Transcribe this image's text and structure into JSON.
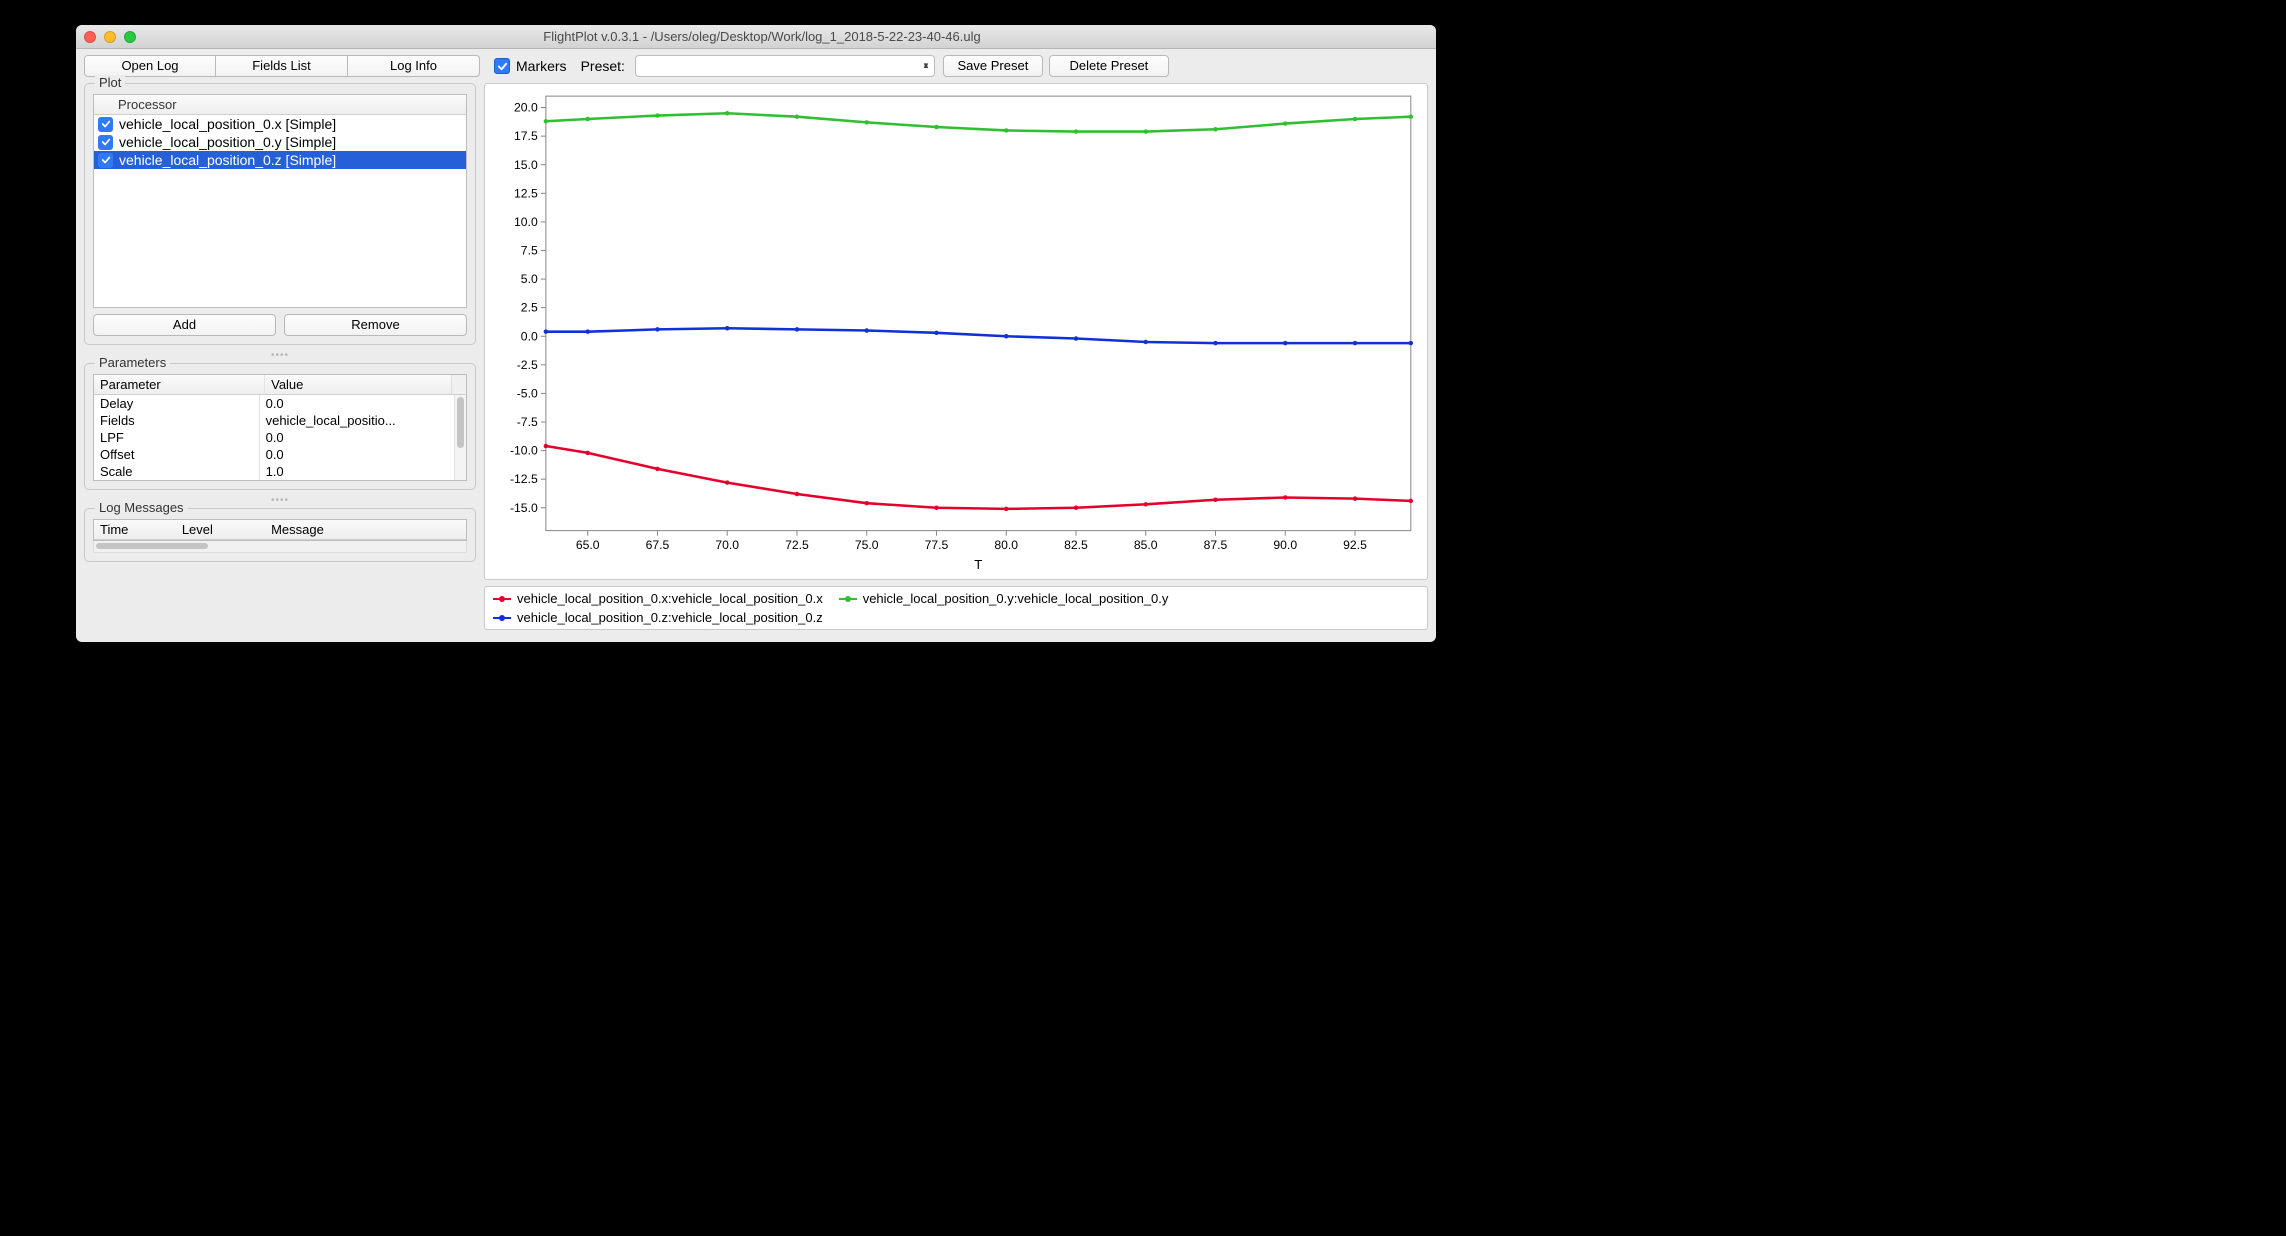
{
  "window": {
    "title": "FlightPlot v.0.3.1 - /Users/oleg/Desktop/Work/log_1_2018-5-22-23-40-46.ulg"
  },
  "toolbar": {
    "open_log": "Open Log",
    "fields_list": "Fields List",
    "log_info": "Log Info",
    "markers_checked": true,
    "markers_label": "Markers",
    "preset_label": "Preset:",
    "preset_value": "",
    "save_preset": "Save Preset",
    "delete_preset": "Delete Preset"
  },
  "plot_panel": {
    "title": "Plot",
    "header": "Processor",
    "items": [
      {
        "label": "vehicle_local_position_0.x [Simple]",
        "checked": true,
        "selected": false
      },
      {
        "label": "vehicle_local_position_0.y [Simple]",
        "checked": true,
        "selected": false
      },
      {
        "label": "vehicle_local_position_0.z [Simple]",
        "checked": true,
        "selected": true
      }
    ],
    "add": "Add",
    "remove": "Remove"
  },
  "parameters": {
    "title": "Parameters",
    "columns": [
      "Parameter",
      "Value"
    ],
    "rows": [
      {
        "name": "Delay",
        "value": "0.0"
      },
      {
        "name": "Fields",
        "value": "vehicle_local_positio..."
      },
      {
        "name": "LPF",
        "value": "0.0"
      },
      {
        "name": "Offset",
        "value": "0.0"
      },
      {
        "name": "Scale",
        "value": "1.0"
      }
    ]
  },
  "log_messages": {
    "title": "Log Messages",
    "columns": [
      "Time",
      "Level",
      "Message"
    ]
  },
  "legend": [
    {
      "color": "#e4002b",
      "label": "vehicle_local_position_0.x:vehicle_local_position_0.x"
    },
    {
      "color": "#2fbf2f",
      "label": "vehicle_local_position_0.y:vehicle_local_position_0.y"
    },
    {
      "color": "#1030d8",
      "label": "vehicle_local_position_0.z:vehicle_local_position_0.z"
    }
  ],
  "chart_data": {
    "type": "line",
    "xlabel": "T",
    "ylabel": "",
    "xlim": [
      63.5,
      94.5
    ],
    "ylim": [
      -17.0,
      21.0
    ],
    "x_ticks": [
      65.0,
      67.5,
      70.0,
      72.5,
      75.0,
      77.5,
      80.0,
      82.5,
      85.0,
      87.5,
      90.0,
      92.5
    ],
    "y_ticks": [
      -15.0,
      -12.5,
      -10.0,
      -7.5,
      -5.0,
      -2.5,
      0.0,
      2.5,
      5.0,
      7.5,
      10.0,
      12.5,
      15.0,
      17.5,
      20.0
    ],
    "x": [
      63.5,
      65.0,
      67.5,
      70.0,
      72.5,
      75.0,
      77.5,
      80.0,
      82.5,
      85.0,
      87.5,
      90.0,
      92.5,
      94.5
    ],
    "series": [
      {
        "name": "vehicle_local_position_0.x",
        "color": "#e4002b",
        "values": [
          -9.6,
          -10.2,
          -11.6,
          -12.8,
          -13.8,
          -14.6,
          -15.0,
          -15.1,
          -15.0,
          -14.7,
          -14.3,
          -14.1,
          -14.2,
          -14.4
        ]
      },
      {
        "name": "vehicle_local_position_0.y",
        "color": "#2fbf2f",
        "values": [
          18.8,
          19.0,
          19.3,
          19.5,
          19.2,
          18.7,
          18.3,
          18.0,
          17.9,
          17.9,
          18.1,
          18.6,
          19.0,
          19.2
        ]
      },
      {
        "name": "vehicle_local_position_0.z",
        "color": "#1030d8",
        "values": [
          0.4,
          0.4,
          0.6,
          0.7,
          0.6,
          0.5,
          0.3,
          0.0,
          -0.2,
          -0.5,
          -0.6,
          -0.6,
          -0.6,
          -0.6
        ]
      }
    ]
  }
}
